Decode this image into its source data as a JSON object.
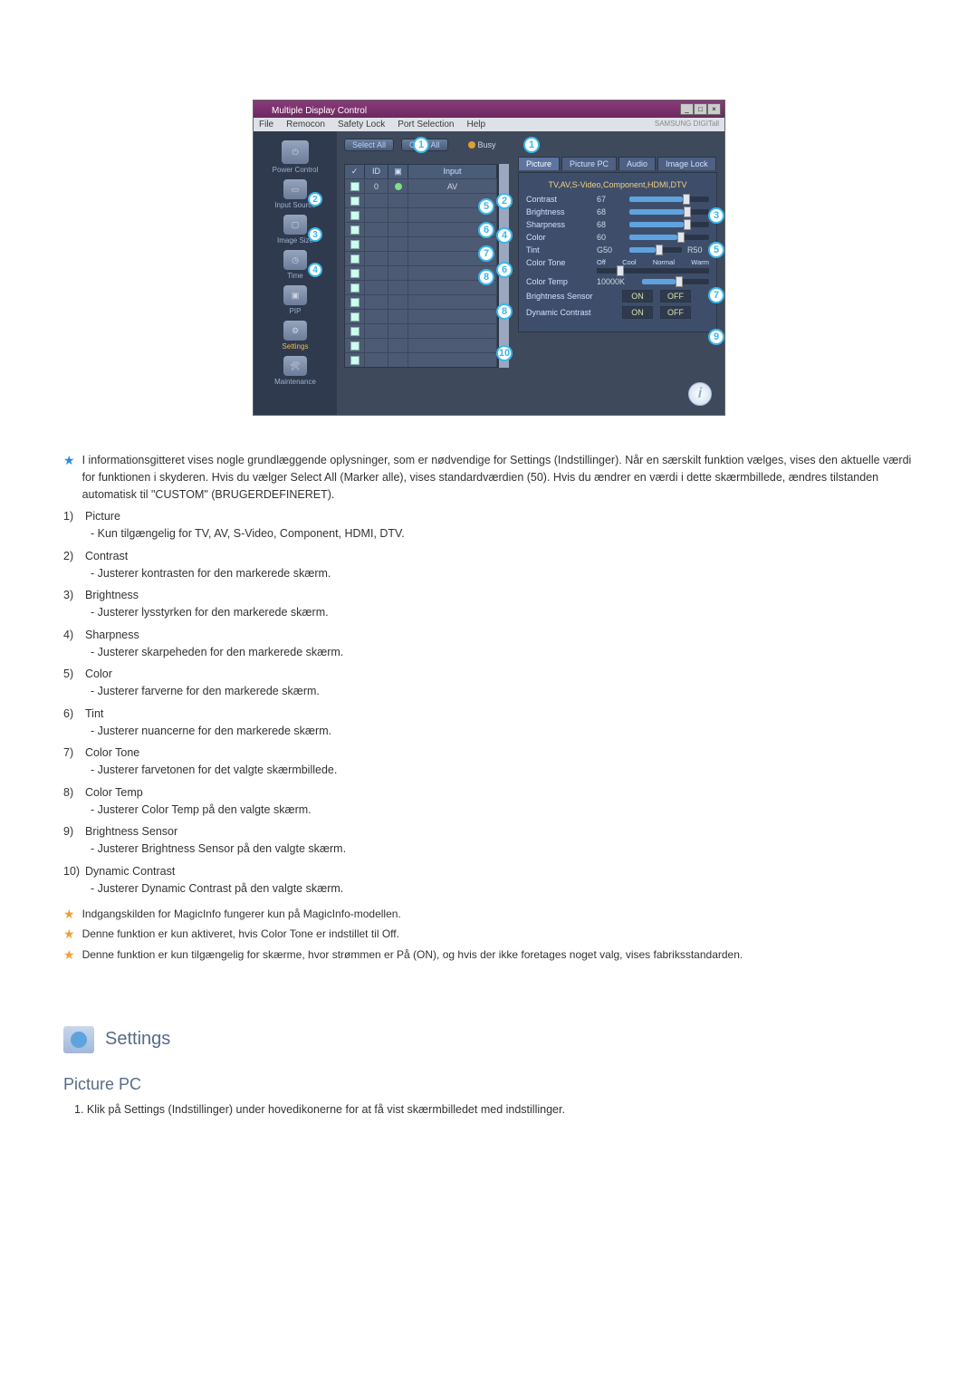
{
  "window": {
    "title": "Multiple Display Control",
    "menu": [
      "File",
      "Remocon",
      "Safety Lock",
      "Port Selection",
      "Help"
    ],
    "brand": "SAMSUNG DIGITall"
  },
  "sidebar": {
    "items": [
      {
        "label": "Power Control"
      },
      {
        "label": "Input Source"
      },
      {
        "label": "Image Size"
      },
      {
        "label": "Time"
      },
      {
        "label": "PIP"
      },
      {
        "label": "Settings"
      },
      {
        "label": "Maintenance"
      }
    ]
  },
  "toolbar": {
    "select_all": "Select All",
    "clear_all": "Clear All",
    "busy": "Busy"
  },
  "grid": {
    "headers": {
      "c2": "ID",
      "c4": "Input"
    },
    "row0": {
      "id": "0",
      "input": "AV"
    }
  },
  "tabs": {
    "picture": "Picture",
    "picture_pc": "Picture PC",
    "audio": "Audio",
    "image_lock": "Image Lock"
  },
  "panel": {
    "subhead": "TV,AV,S-Video,Component,HDMI,DTV",
    "contrast": {
      "label": "Contrast",
      "value": "67"
    },
    "brightness": {
      "label": "Brightness",
      "value": "68"
    },
    "sharpness": {
      "label": "Sharpness",
      "value": "68"
    },
    "color": {
      "label": "Color",
      "value": "60"
    },
    "tint": {
      "label": "Tint",
      "left": "G50",
      "right": "R50"
    },
    "color_tone": {
      "label": "Color Tone",
      "opts": [
        "Off",
        "Cool",
        "Normal",
        "Warm"
      ]
    },
    "color_temp": {
      "label": "Color Temp",
      "value": "10000K"
    },
    "brightness_sensor": {
      "label": "Brightness Sensor",
      "on": "ON",
      "off": "OFF"
    },
    "dynamic_contrast": {
      "label": "Dynamic Contrast",
      "on": "ON",
      "off": "OFF"
    }
  },
  "desc": {
    "intro": "I informationsgitteret vises nogle grundlæggende oplysninger, som er nødvendige for Settings (Indstillinger). Når en særskilt funktion vælges, vises den aktuelle værdi for funktionen i skyderen. Hvis du vælger Select All (Marker alle), vises standardværdien (50). Hvis du ændrer en værdi i dette skærmbillede, ændres tilstanden automatisk til \"CUSTOM\" (BRUGERDEFINERET).",
    "items": [
      {
        "n": "1)",
        "t": "Picture",
        "d": "- Kun tilgængelig for TV, AV, S-Video, Component, HDMI, DTV."
      },
      {
        "n": "2)",
        "t": "Contrast",
        "d": "- Justerer kontrasten for den markerede skærm."
      },
      {
        "n": "3)",
        "t": "Brightness",
        "d": "- Justerer lysstyrken for den markerede skærm."
      },
      {
        "n": "4)",
        "t": "Sharpness",
        "d": "- Justerer skarpeheden for den markerede skærm."
      },
      {
        "n": "5)",
        "t": "Color",
        "d": "- Justerer farverne for den markerede skærm."
      },
      {
        "n": "6)",
        "t": "Tint",
        "d": "- Justerer nuancerne for den markerede skærm."
      },
      {
        "n": "7)",
        "t": "Color Tone",
        "d": "- Justerer farvetonen for det valgte skærmbillede."
      },
      {
        "n": "8)",
        "t": "Color Temp",
        "d": "- Justerer Color Temp på den valgte skærm."
      },
      {
        "n": "9)",
        "t": "Brightness Sensor",
        "d": "- Justerer Brightness Sensor på den valgte skærm."
      },
      {
        "n": "10)",
        "t": "Dynamic Contrast",
        "d": "- Justerer Dynamic Contrast på den valgte skærm."
      }
    ],
    "notes": [
      "Indgangskilden for MagicInfo fungerer kun på MagicInfo-modellen.",
      "Denne funktion er kun aktiveret, hvis Color Tone er indstillet til Off.",
      "Denne funktion er kun tilgængelig for skærme, hvor strømmen er På (ON), og hvis der ikke foretages noget valg, vises fabriksstandarden."
    ]
  },
  "section": {
    "title": "Settings"
  },
  "subsection": {
    "title": "Picture PC",
    "line1": "1. Klik på Settings (Indstillinger) under hovedikonerne for at få vist skærmbilledet med indstillinger."
  }
}
